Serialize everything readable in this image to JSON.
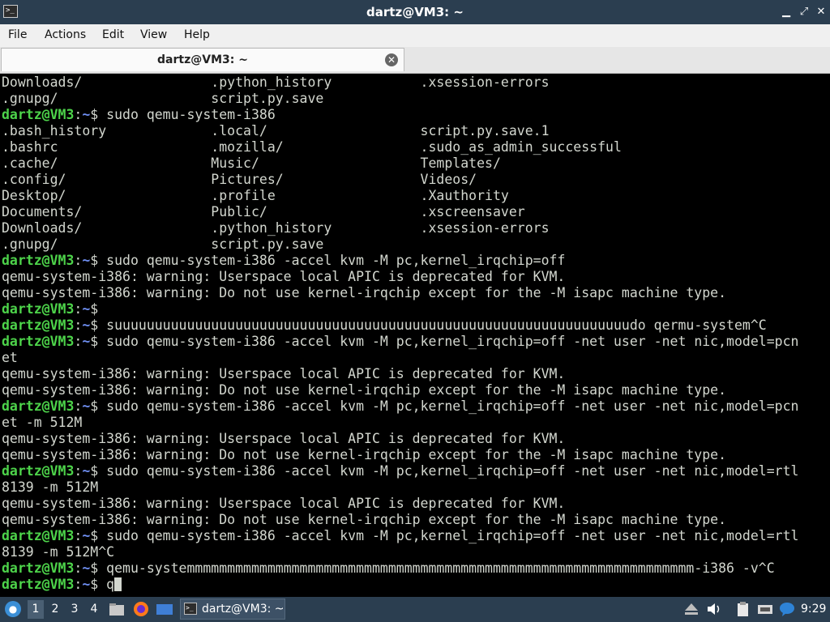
{
  "window": {
    "title": "dartz@VM3: ~"
  },
  "menu": [
    "File",
    "Actions",
    "Edit",
    "View",
    "Help"
  ],
  "tab": {
    "label": "dartz@VM3: ~"
  },
  "terminal": {
    "lines": [
      [
        {
          "t": "Downloads/                .python_history           .xsession-errors"
        }
      ],
      [
        {
          "t": ".gnupg/                   script.py.save"
        }
      ],
      [
        {
          "t": "dartz@VM3",
          "c": "user"
        },
        {
          "t": ":"
        },
        {
          "t": "~",
          "c": "path"
        },
        {
          "t": "$ sudo qemu-system-i386"
        }
      ],
      [
        {
          "t": ".bash_history             .local/                   script.py.save.1"
        }
      ],
      [
        {
          "t": ".bashrc                   .mozilla/                 .sudo_as_admin_successful"
        }
      ],
      [
        {
          "t": ".cache/                   Music/                    Templates/"
        }
      ],
      [
        {
          "t": ".config/                  Pictures/                 Videos/"
        }
      ],
      [
        {
          "t": "Desktop/                  .profile                  .Xauthority"
        }
      ],
      [
        {
          "t": "Documents/                Public/                   .xscreensaver"
        }
      ],
      [
        {
          "t": "Downloads/                .python_history           .xsession-errors"
        }
      ],
      [
        {
          "t": ".gnupg/                   script.py.save"
        }
      ],
      [
        {
          "t": "dartz@VM3",
          "c": "user"
        },
        {
          "t": ":"
        },
        {
          "t": "~",
          "c": "path"
        },
        {
          "t": "$ sudo qemu-system-i386 -accel kvm -M pc,kernel_irqchip=off"
        }
      ],
      [
        {
          "t": "qemu-system-i386: warning: Userspace local APIC is deprecated for KVM."
        }
      ],
      [
        {
          "t": "qemu-system-i386: warning: Do not use kernel-irqchip except for the -M isapc machine type."
        }
      ],
      [
        {
          "t": "dartz@VM3",
          "c": "user"
        },
        {
          "t": ":"
        },
        {
          "t": "~",
          "c": "path"
        },
        {
          "t": "$"
        }
      ],
      [
        {
          "t": "dartz@VM3",
          "c": "user"
        },
        {
          "t": ":"
        },
        {
          "t": "~",
          "c": "path"
        },
        {
          "t": "$ suuuuuuuuuuuuuuuuuuuuuuuuuuuuuuuuuuuuuuuuuuuuuuuuuuuuuuuuuuuuuuuudo qermu-system^C"
        }
      ],
      [
        {
          "t": "dartz@VM3",
          "c": "user"
        },
        {
          "t": ":"
        },
        {
          "t": "~",
          "c": "path"
        },
        {
          "t": "$ sudo qemu-system-i386 -accel kvm -M pc,kernel_irqchip=off -net user -net nic,model=pcn"
        }
      ],
      [
        {
          "t": "et"
        }
      ],
      [
        {
          "t": "qemu-system-i386: warning: Userspace local APIC is deprecated for KVM."
        }
      ],
      [
        {
          "t": "qemu-system-i386: warning: Do not use kernel-irqchip except for the -M isapc machine type."
        }
      ],
      [
        {
          "t": "dartz@VM3",
          "c": "user"
        },
        {
          "t": ":"
        },
        {
          "t": "~",
          "c": "path"
        },
        {
          "t": "$ sudo qemu-system-i386 -accel kvm -M pc,kernel_irqchip=off -net user -net nic,model=pcn"
        }
      ],
      [
        {
          "t": "et -m 512M"
        }
      ],
      [
        {
          "t": "qemu-system-i386: warning: Userspace local APIC is deprecated for KVM."
        }
      ],
      [
        {
          "t": "qemu-system-i386: warning: Do not use kernel-irqchip except for the -M isapc machine type."
        }
      ],
      [
        {
          "t": "dartz@VM3",
          "c": "user"
        },
        {
          "t": ":"
        },
        {
          "t": "~",
          "c": "path"
        },
        {
          "t": "$ sudo qemu-system-i386 -accel kvm -M pc,kernel_irqchip=off -net user -net nic,model=rtl"
        }
      ],
      [
        {
          "t": "8139 -m 512M"
        }
      ],
      [
        {
          "t": "qemu-system-i386: warning: Userspace local APIC is deprecated for KVM."
        }
      ],
      [
        {
          "t": "qemu-system-i386: warning: Do not use kernel-irqchip except for the -M isapc machine type."
        }
      ],
      [
        {
          "t": "dartz@VM3",
          "c": "user"
        },
        {
          "t": ":"
        },
        {
          "t": "~",
          "c": "path"
        },
        {
          "t": "$ sudo qemu-system-i386 -accel kvm -M pc,kernel_irqchip=off -net user -net nic,model=rtl"
        }
      ],
      [
        {
          "t": "8139 -m 512M^C"
        }
      ],
      [
        {
          "t": "dartz@VM3",
          "c": "user"
        },
        {
          "t": ":"
        },
        {
          "t": "~",
          "c": "path"
        },
        {
          "t": "$ qemu-systemmmmmmmmmmmmmmmmmmmmmmmmmmmmmmmmmmmmmmmmmmmmmmmmmmmmmmmmmmmmmmm-i386 -v^C"
        }
      ],
      [
        {
          "t": "dartz@VM3",
          "c": "user"
        },
        {
          "t": ":"
        },
        {
          "t": "~",
          "c": "path"
        },
        {
          "t": "$ q"
        }
      ]
    ]
  },
  "taskbar": {
    "workspaces": [
      "1",
      "2",
      "3",
      "4"
    ],
    "active_workspace": "1",
    "task_label": "dartz@VM3: ~",
    "clock": "9:29",
    "icons": [
      "start-menu-icon",
      "file-manager-icon",
      "firefox-icon",
      "desktop-icon",
      "terminal-icon",
      "eject-icon",
      "volume-icon",
      "clipboard-icon",
      "network-icon",
      "chat-icon"
    ]
  },
  "colors": {
    "prompt_user": "#4dd34a",
    "prompt_path": "#6f8ff2",
    "terminal_text": "#d3d7cf",
    "chrome": "#2b3e50"
  }
}
